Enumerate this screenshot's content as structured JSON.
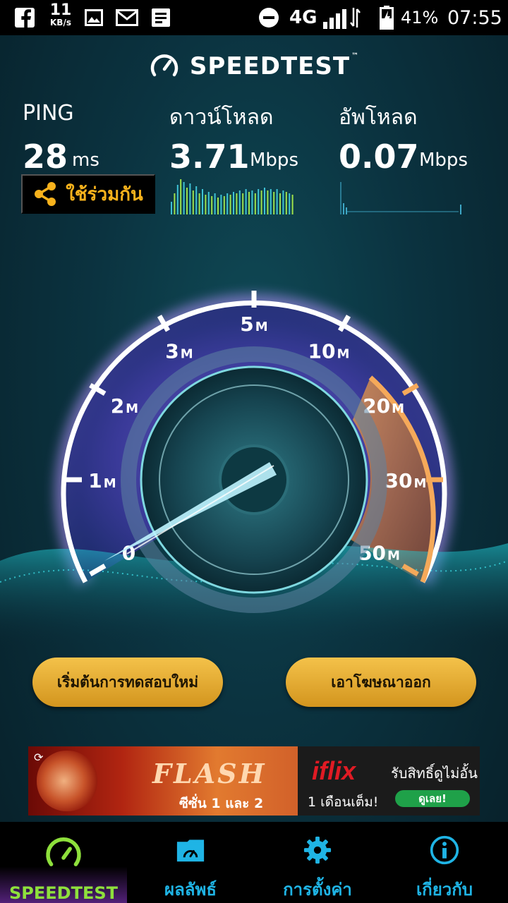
{
  "status_bar": {
    "speed_value": "11",
    "speed_unit": "KB/s",
    "network": "4G",
    "battery": "41%",
    "time": "07:55",
    "icons": [
      "facebook-icon",
      "gallery-icon",
      "gmail-icon",
      "notes-icon",
      "dnd-icon",
      "signal-icon",
      "battery-icon"
    ]
  },
  "header": {
    "title": "SPEEDTEST",
    "tm": "™"
  },
  "metrics": {
    "ping": {
      "label": "PING",
      "value": "28",
      "unit": "ms"
    },
    "download": {
      "label": "ดาวน์โหลด",
      "value": "3.71",
      "unit": "Mbps"
    },
    "upload": {
      "label": "อัพโหลด",
      "value": "0.07",
      "unit": "Mbps"
    },
    "share_label": "ใช้ร่วมกัน"
  },
  "gauge": {
    "ticks": [
      {
        "num": "0",
        "unit": ""
      },
      {
        "num": "1",
        "unit": "M"
      },
      {
        "num": "2",
        "unit": "M"
      },
      {
        "num": "3",
        "unit": "M"
      },
      {
        "num": "5",
        "unit": "M"
      },
      {
        "num": "10",
        "unit": "M"
      },
      {
        "num": "20",
        "unit": "M"
      },
      {
        "num": "30",
        "unit": "M"
      },
      {
        "num": "50",
        "unit": "M"
      }
    ],
    "colors": {
      "ring": "#ffffff",
      "arc_glow": "#a77cff",
      "hot_zone": "#f08a32",
      "needle": "#bff4ff"
    }
  },
  "actions": {
    "restart": "เริ่มต้นการทดสอบใหม่",
    "remove_ads": "เอาโฆษณาออก"
  },
  "ad": {
    "show_title": "FLASH",
    "show_season": "ซีซั่น 1 และ 2",
    "brand": "iflix",
    "tagline": "รับสิทธิ์ดูไม่อั้น",
    "offer": "1 เดือนเต็ม!",
    "cta": "ดูเลย!"
  },
  "nav": {
    "items": [
      {
        "label": "SPEEDTEST",
        "icon": "speedometer-icon"
      },
      {
        "label": "ผลลัพธ์",
        "icon": "results-folder-icon"
      },
      {
        "label": "การตั้งค่า",
        "icon": "gear-icon"
      },
      {
        "label": "เกี่ยวกับ",
        "icon": "info-icon"
      }
    ],
    "colors": {
      "active": "#8ee03c",
      "inactive": "#1fb4e5"
    }
  }
}
